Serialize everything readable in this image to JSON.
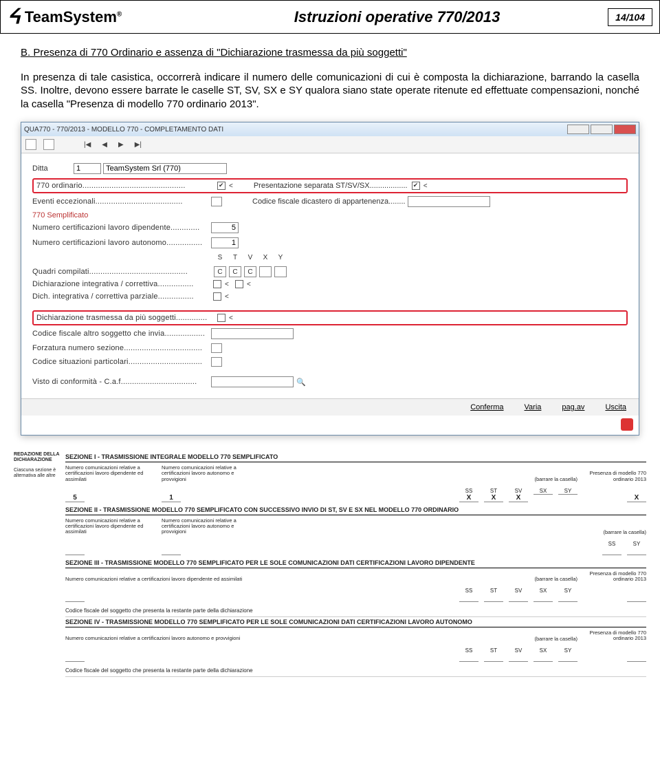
{
  "header": {
    "brand": "TeamSystem",
    "registered": "®",
    "title": "Istruzioni operative 770/2013",
    "page": "14/104"
  },
  "body": {
    "heading": "B. Presenza di 770 Ordinario e assenza di \"Dichiarazione trasmessa da più soggetti\"",
    "para": "In presenza di tale casistica, occorrerà indicare il numero delle comunicazioni di cui è composta la dichiarazione, barrando la casella SS. Inoltre, devono essere barrate le caselle ST, SV, SX e SY qualora siano state operate ritenute ed effettuate compensazioni, nonché la casella \"Presenza di modello 770 ordinario 2013\"."
  },
  "app": {
    "title": "QUA770 - 770/2013 - MODELLO 770 - COMPLETAMENTO DATI",
    "ditta_label": "Ditta",
    "ditta_code": "1",
    "ditta_name": "TeamSystem Srl (770)",
    "ordinario_label": "770 ordinario..............................................",
    "ordinario_checked": "✔",
    "pres_sep_label": "Presentazione separata ST/SV/SX..................",
    "pres_sep_checked": "✔",
    "eventi_label": "Eventi eccezionali.......................................",
    "codfis_dic_label": "Codice fiscale dicastero di appartenenza........",
    "semplificato_heading": "770 Semplificato",
    "num_cert_dip_label": "Numero certificazioni lavoro dipendente.............",
    "num_cert_dip": "5",
    "num_cert_aut_label": "Numero certificazioni lavoro autonomo................",
    "num_cert_aut": "1",
    "quadri_label": "Quadri compilati............................................",
    "quadri_letters": [
      "S",
      "T",
      "V",
      "X",
      "Y"
    ],
    "quadri_vals": [
      "C",
      "C",
      "C",
      "",
      ""
    ],
    "dich_integ_label": "Dichiarazione integrativa / correttiva................",
    "dich_integ_parz_label": "Dich. integrativa / correttiva parziale................",
    "trasmessa_label": "Dichiarazione trasmessa da più soggetti..............",
    "codfis_altro_label": "Codice fiscale altro soggetto che invia..................",
    "forzatura_label": "Forzatura numero sezione...................................",
    "codsit_label": "Codice situazioni particolari.................................",
    "visto_label": "Visto di conformità - C.a.f..................................",
    "conferma": "Conferma",
    "varia": "Varia",
    "pagav": "pag.av",
    "uscita": "Uscita"
  },
  "form": {
    "side_title": "REDAZIONE DELLA DICHIARAZIONE",
    "side_sub": "Ciascuna sezione è alternativa alle altre",
    "sec1_title": "SEZIONE I - TRASMISSIONE INTEGRALE MODELLO 770 SEMPLIFICATO",
    "num_com_dip": "Numero comunicazioni relative a certificazioni lavoro dipendente ed assimilati",
    "num_com_aut": "Numero comunicazioni relative a certificazioni lavoro autonomo e provvigioni",
    "barrare": "(barrare la casella)",
    "presenza_mod": "Presenza di modello 770 ordinario 2013",
    "val_dip": "5",
    "val_aut": "1",
    "sec1_cells": {
      "SS": "X",
      "ST": "X",
      "SV": "X",
      "SX": "",
      "SY": "",
      "PRES": "X"
    },
    "sec2_title": "SEZIONE II - TRASMISSIONE MODELLO 770 SEMPLIFICATO CON SUCCESSIVO INVIO DI ST, SV E SX NEL MODELLO 770 ORDINARIO",
    "sec3_title": "SEZIONE III - TRASMISSIONE MODELLO 770 SEMPLIFICATO PER LE SOLE COMUNICAZIONI DATI CERTIFICAZIONI LAVORO DIPENDENTE",
    "sec3_line": "Numero comunicazioni relative a certificazioni lavoro dipendente ed assimilati",
    "clause_cf": "Codice fiscale del soggetto che presenta la restante parte della dichiarazione",
    "sec4_title": "SEZIONE IV - TRASMISSIONE MODELLO 770 SEMPLIFICATO PER LE SOLE COMUNICAZIONI DATI CERTIFICAZIONI LAVORO AUTONOMO",
    "sec4_line": "Numero comunicazioni relative a certificazioni lavoro autonomo e provvigioni"
  }
}
